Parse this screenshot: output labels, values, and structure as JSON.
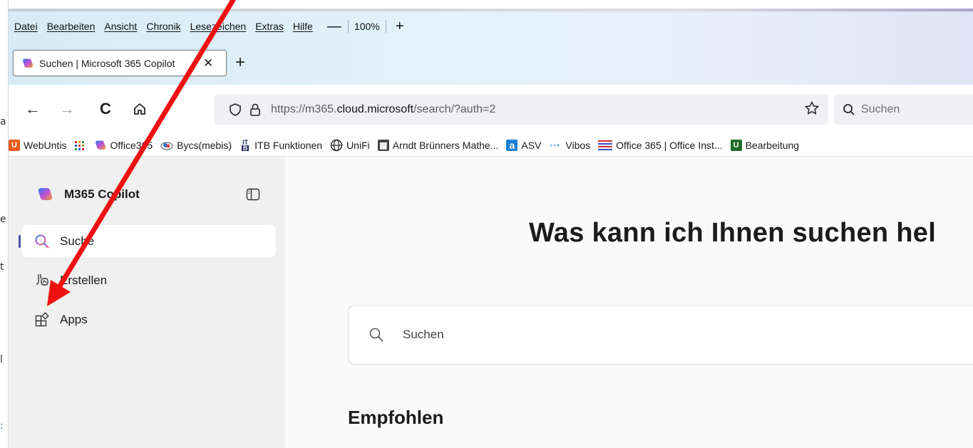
{
  "menubar": {
    "items": [
      "Datei",
      "Bearbeiten",
      "Ansicht",
      "Chronik",
      "Lesezeichen",
      "Extras",
      "Hilfe"
    ],
    "zoom_minus": "—",
    "zoom_level": "100%",
    "zoom_plus": "+"
  },
  "tab": {
    "title": "Suchen | Microsoft 365 Copilot",
    "close": "✕",
    "new_tab": "+"
  },
  "navbar": {
    "back": "←",
    "forward": "→",
    "reload": "C",
    "url_prefix": "https://m365.",
    "url_domain": "cloud.microsoft",
    "url_path": "/search/?auth=2",
    "search_placeholder": "Suchen"
  },
  "bookmarks": [
    {
      "label": "WebUntis",
      "icon": "webuntis-icon",
      "color": "#e8591a",
      "glyph": "U"
    },
    {
      "label": "",
      "icon": "apps-grid-icon",
      "color": "#ffffff",
      "glyph": ""
    },
    {
      "label": "Office365",
      "icon": "copilot-icon",
      "color": "#ffffff",
      "glyph": ""
    },
    {
      "label": "Bycs(mebis)",
      "icon": "cloud-icon",
      "color": "#ffffff",
      "glyph": ""
    },
    {
      "label": "ITB Funktionen",
      "icon": "itb-icon",
      "color": "#1f2a5a",
      "glyph": "IT"
    },
    {
      "label": "UniFi",
      "icon": "globe-icon",
      "color": "#ffffff",
      "glyph": ""
    },
    {
      "label": "Arndt Brünners Mathe...",
      "icon": "math-icon",
      "color": "#333333",
      "glyph": "▦"
    },
    {
      "label": "ASV",
      "icon": "asv-icon",
      "color": "#1a7fd4",
      "glyph": "a"
    },
    {
      "label": "Vibos",
      "icon": "vibos-icon",
      "color": "#ffffff",
      "glyph": ""
    },
    {
      "label": "Office 365 | Office Inst...",
      "icon": "office-lines-icon",
      "color": "#ffffff",
      "glyph": ""
    },
    {
      "label": "Bearbeitung",
      "icon": "bearbeitung-icon",
      "color": "#1e6b2a",
      "glyph": "U"
    }
  ],
  "sidebar": {
    "brand": "M365 Copilot",
    "items": [
      {
        "label": "Suche",
        "icon": "search-icon",
        "active": true
      },
      {
        "label": "Erstellen",
        "icon": "create-icon",
        "active": false
      },
      {
        "label": "Apps",
        "icon": "apps-icon",
        "active": false
      }
    ]
  },
  "main": {
    "heading": "Was kann ich Ihnen suchen hel",
    "search_placeholder": "Suchen",
    "recommended": "Empfohlen"
  },
  "colors": {
    "accent": "#4f52b2",
    "annotation_arrow": "#ee1111"
  }
}
